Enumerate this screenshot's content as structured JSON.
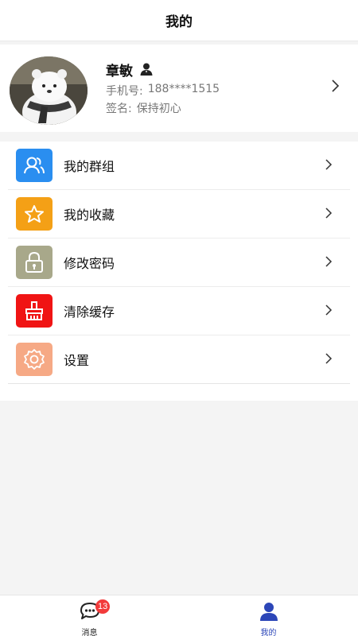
{
  "header": {
    "title": "我的"
  },
  "profile": {
    "name": "章敏",
    "phone_label": "手机号:",
    "phone_value": "188****1515",
    "signature_label": "签名:",
    "signature_value": "保持初心"
  },
  "menu": {
    "items": [
      {
        "label": "我的群组",
        "icon": "group-icon",
        "color": "#2a8ef0"
      },
      {
        "label": "我的收藏",
        "icon": "star-icon",
        "color": "#f4a016"
      },
      {
        "label": "修改密码",
        "icon": "lock-icon",
        "color": "#a8a88a"
      },
      {
        "label": "清除缓存",
        "icon": "broom-icon",
        "color": "#f01414"
      },
      {
        "label": "设置",
        "icon": "gear-icon",
        "color": "#f6a985"
      }
    ]
  },
  "tabbar": {
    "tabs": [
      {
        "label": "消息",
        "badge": "13"
      },
      {
        "label": "我的"
      }
    ]
  },
  "colors": {
    "accent": "#2c46b8",
    "badge": "#f23a3a"
  }
}
